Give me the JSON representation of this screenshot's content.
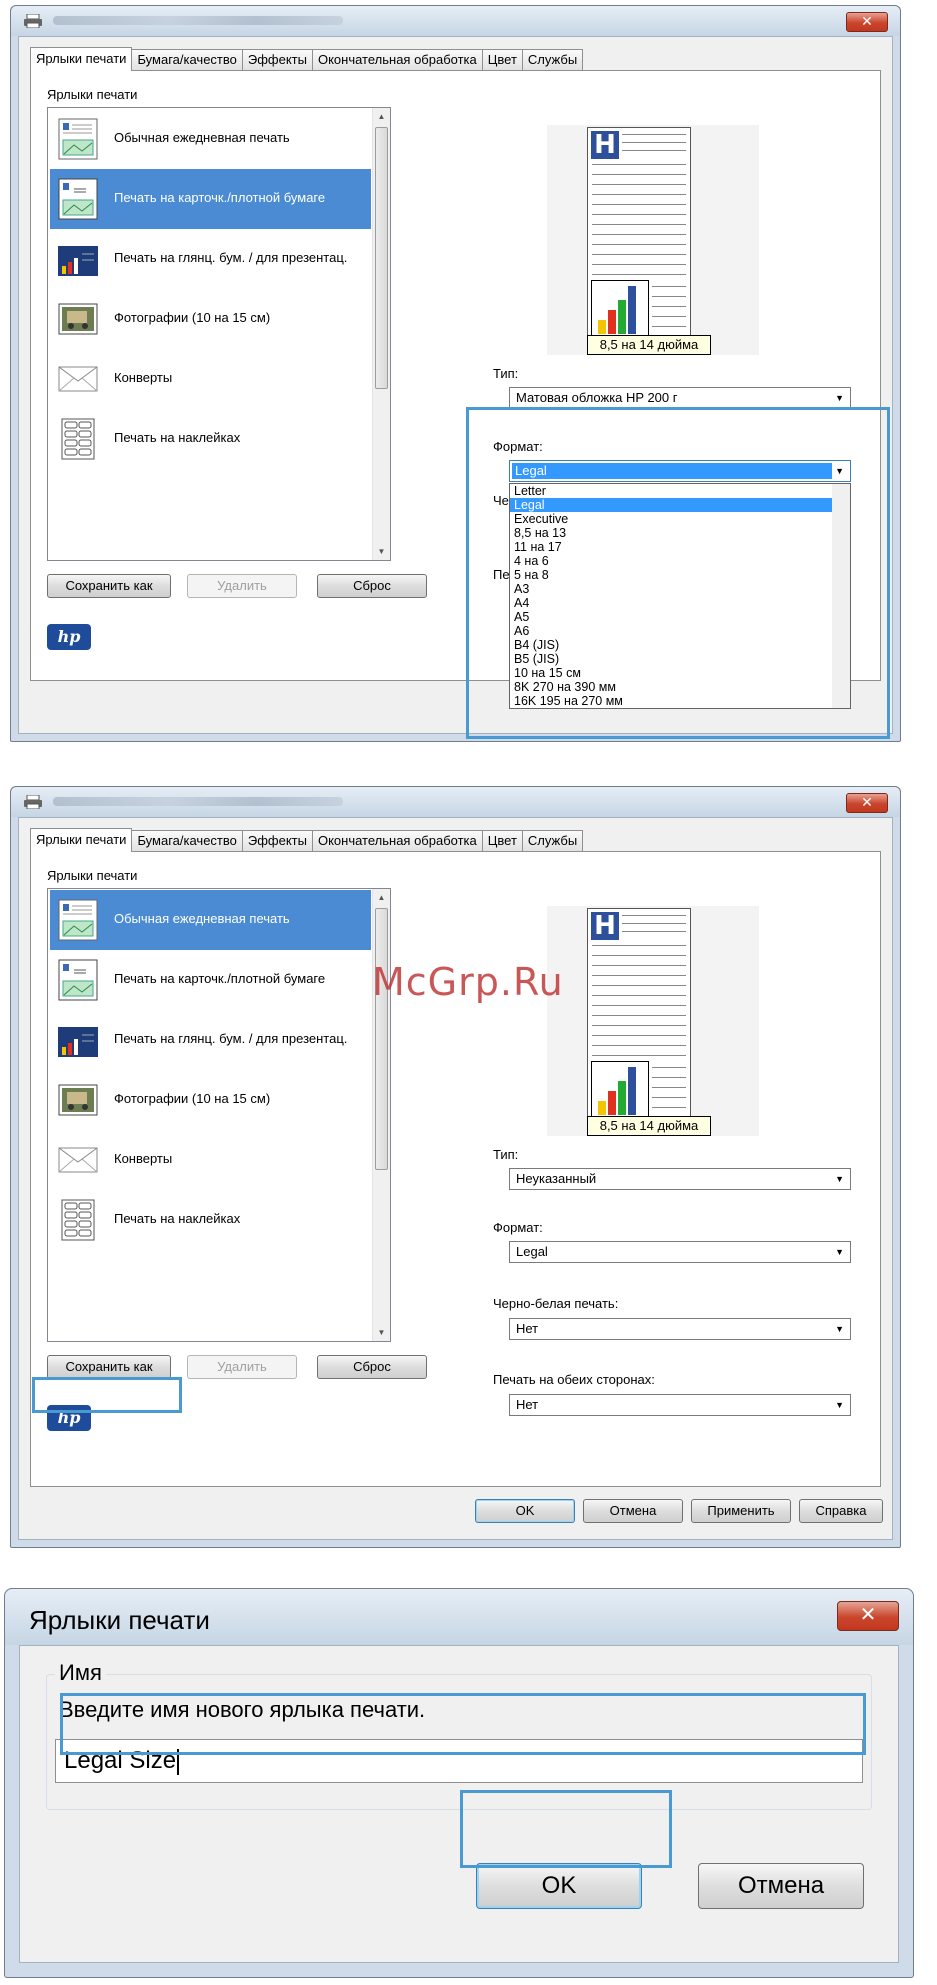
{
  "dialog_tabs": [
    "Ярлыки печати",
    "Бумага/качество",
    "Эффекты",
    "Окончательная обработка",
    "Цвет",
    "Службы"
  ],
  "shortcuts_group_label": "Ярлыки печати",
  "shortcuts": [
    {
      "label": "Обычная ежедневная печать",
      "icon": "document-icon"
    },
    {
      "label": "Печать на карточк./плотной бумаге",
      "icon": "card-document-icon"
    },
    {
      "label": "Печать на глянц. бум. / для презентац.",
      "icon": "presentation-icon"
    },
    {
      "label": "Фотографии (10 на 15 см)",
      "icon": "photo-icon"
    },
    {
      "label": "Конверты",
      "icon": "envelope-icon"
    },
    {
      "label": "Печать на наклейках",
      "icon": "labels-icon"
    }
  ],
  "buttons": {
    "save_as": "Сохранить как",
    "delete": "Удалить",
    "reset": "Сброс",
    "ok": "OK",
    "cancel": "Отмена",
    "apply": "Применить",
    "help": "Справка"
  },
  "preview_size_label": "8,5 на 14 дюйма",
  "preview_letter": "H",
  "logo_text": "hp",
  "labels": {
    "type": "Тип:",
    "format": "Формат:",
    "bw": "Черно-белая печать:",
    "duplex": "Печать на обеих сторонах:",
    "bw_short": "Че",
    "duplex_short": "Пе"
  },
  "screen1": {
    "selected_shortcut": 1,
    "type_value": "Матовая обложка HP 200 г",
    "format_value": "Legal",
    "format_options": [
      "Letter",
      "Legal",
      "Executive",
      "8,5 на 13",
      "11 на 17",
      "4 на 6",
      "5 на 8",
      "A3",
      "A4",
      "A5",
      "A6",
      "B4 (JIS)",
      "B5 (JIS)",
      "10 на 15 см",
      "8K 270 на 390 мм",
      "16K 195 на 270 мм"
    ],
    "selected_option": "Legal"
  },
  "screen2": {
    "selected_shortcut": 0,
    "type_value": "Неуказанный",
    "format_value": "Legal",
    "bw_value": "Нет",
    "duplex_value": "Нет"
  },
  "watermark": "McGrp.Ru",
  "name_dialog": {
    "title": "Ярлыки печати",
    "close": "✕",
    "legend": "Имя",
    "prompt": "Введите имя нового ярлыка печати.",
    "input_value": "Legal Size",
    "ok": "OK",
    "cancel": "Отмена"
  },
  "colors": {
    "selection": "#4a8bd4",
    "highlight": "#4a9ad2",
    "close": "#c9452c"
  }
}
